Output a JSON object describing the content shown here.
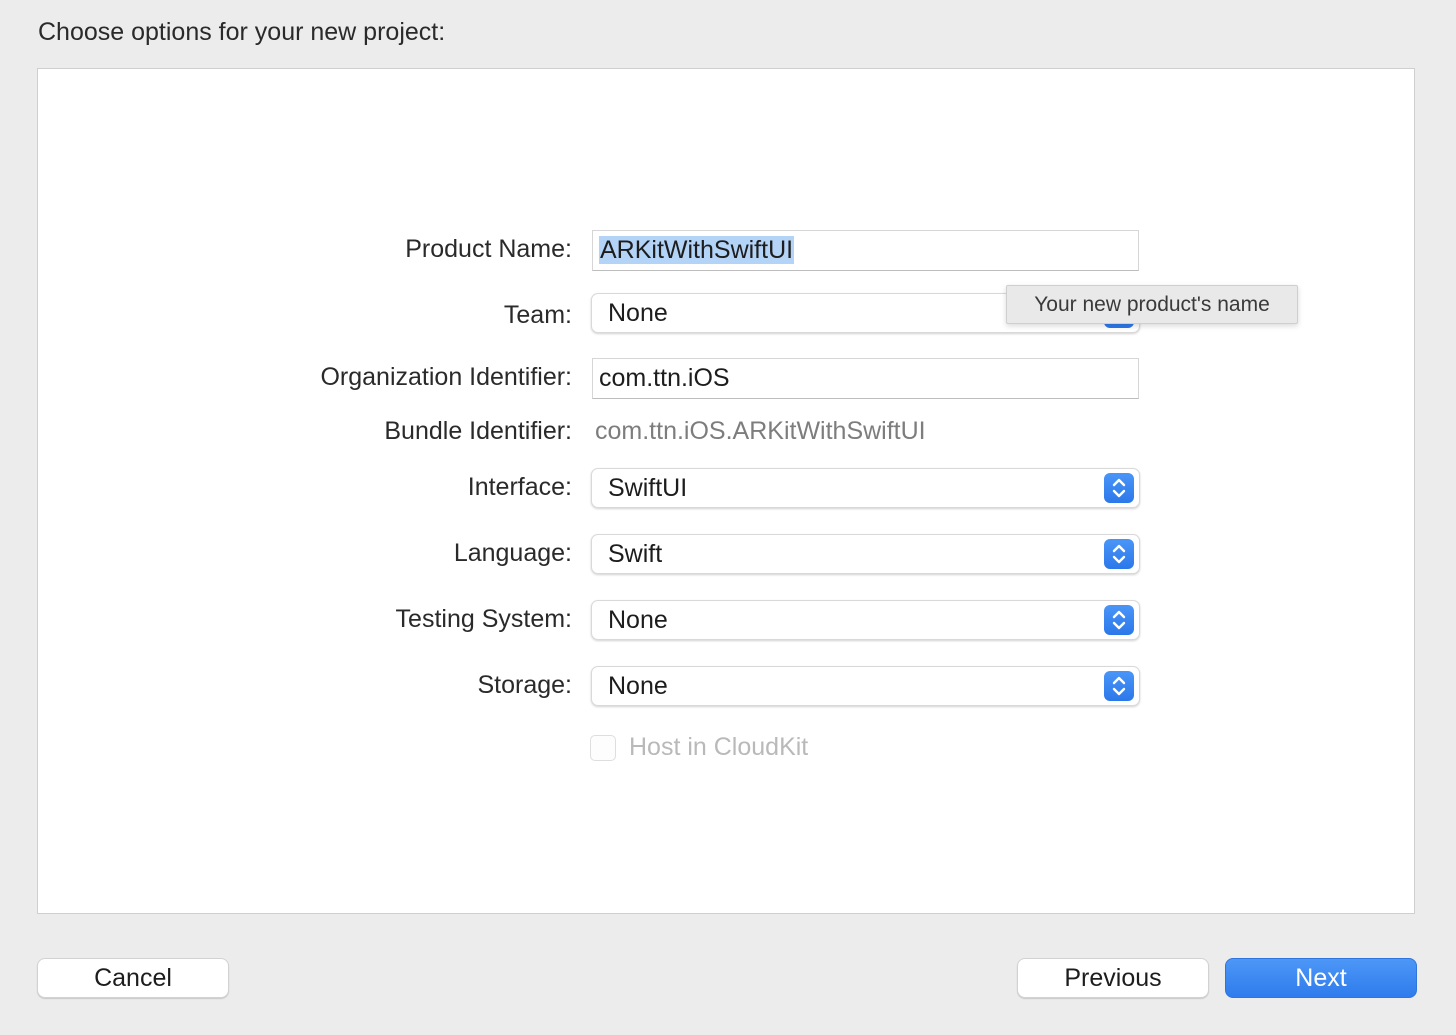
{
  "header": {
    "title": "Choose options for your new project:"
  },
  "form": {
    "product_name": {
      "label": "Product Name:",
      "value": "ARKitWithSwiftUI"
    },
    "team": {
      "label": "Team:",
      "value": "None"
    },
    "organization_identifier": {
      "label": "Organization Identifier:",
      "value": "com.ttn.iOS"
    },
    "bundle_identifier": {
      "label": "Bundle Identifier:",
      "value": "com.ttn.iOS.ARKitWithSwiftUI"
    },
    "interface": {
      "label": "Interface:",
      "value": "SwiftUI"
    },
    "language": {
      "label": "Language:",
      "value": "Swift"
    },
    "testing_system": {
      "label": "Testing System:",
      "value": "None"
    },
    "storage": {
      "label": "Storage:",
      "value": "None"
    },
    "host_in_cloudkit": {
      "label": "Host in CloudKit",
      "checked": false,
      "enabled": false
    }
  },
  "tooltip": {
    "text": "Your new product's name"
  },
  "footer": {
    "cancel_label": "Cancel",
    "previous_label": "Previous",
    "next_label": "Next"
  },
  "colors": {
    "accent": "#2e7ced",
    "selection": "#b3d3f7",
    "background": "#ececec"
  },
  "icons": {
    "popup_stepper": "up-down-chevron-icon"
  }
}
